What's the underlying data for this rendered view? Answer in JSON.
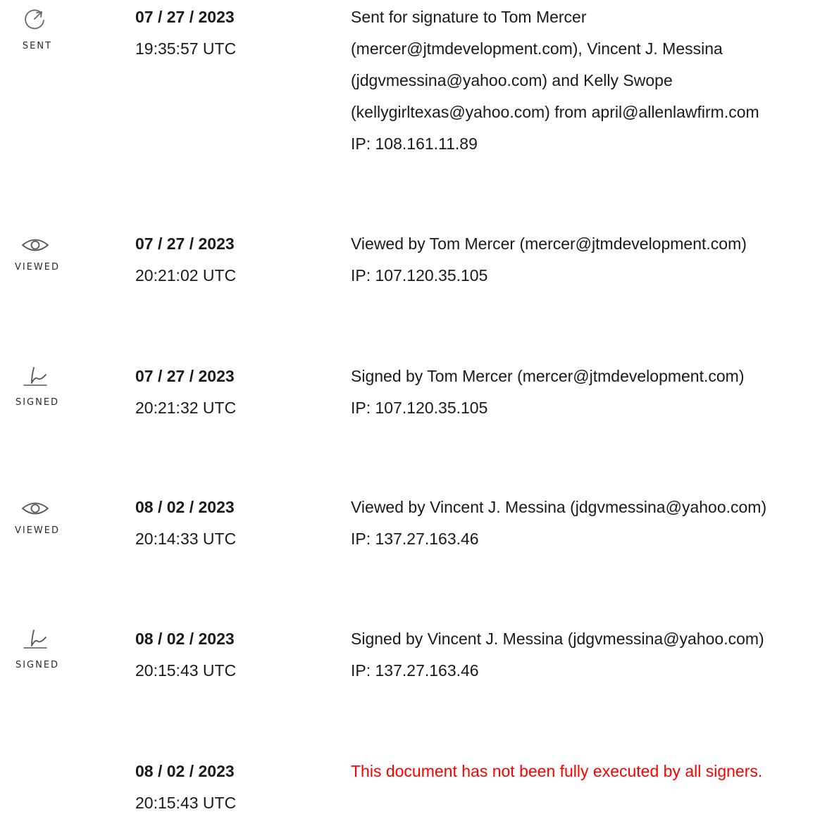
{
  "entries": [
    {
      "icon": "send-icon",
      "label": "SENT",
      "date": "07 / 27 / 2023",
      "time": "19:35:57 UTC",
      "lines": [
        "Sent for signature to Tom Mercer",
        "(mercer@jtmdevelopment.com), Vincent J. Messina",
        "(jdgvmessina@yahoo.com) and Kelly Swope",
        "(kellygirltexas@yahoo.com) from april@allenlawfirm.com",
        "IP: 108.161.11.89"
      ]
    },
    {
      "icon": "eye-icon",
      "label": "VIEWED",
      "date": "07 / 27 / 2023",
      "time": "20:21:02 UTC",
      "lines": [
        "Viewed by Tom Mercer (mercer@jtmdevelopment.com)",
        "IP: 107.120.35.105"
      ]
    },
    {
      "icon": "signature-icon",
      "label": "SIGNED",
      "date": "07 / 27 / 2023",
      "time": "20:21:32 UTC",
      "lines": [
        "Signed by Tom Mercer (mercer@jtmdevelopment.com)",
        "IP: 107.120.35.105"
      ]
    },
    {
      "icon": "eye-icon",
      "label": "VIEWED",
      "date": "08 / 02 / 2023",
      "time": "20:14:33 UTC",
      "lines": [
        "Viewed by Vincent J. Messina (jdgvmessina@yahoo.com)",
        "IP: 137.27.163.46"
      ]
    },
    {
      "icon": "signature-icon",
      "label": "SIGNED",
      "date": "08 / 02 / 2023",
      "time": "20:15:43 UTC",
      "lines": [
        "Signed by Vincent J. Messina (jdgvmessina@yahoo.com)",
        "IP: 137.27.163.46"
      ]
    },
    {
      "icon": "",
      "label": "",
      "date": "08 / 02 / 2023",
      "time": "20:15:43 UTC",
      "lines": [
        "This document has not been fully executed by all signers."
      ]
    }
  ],
  "colors": {
    "text": "#1a1a1a",
    "warning": "#ff0000",
    "icon_stroke": "#555555"
  }
}
